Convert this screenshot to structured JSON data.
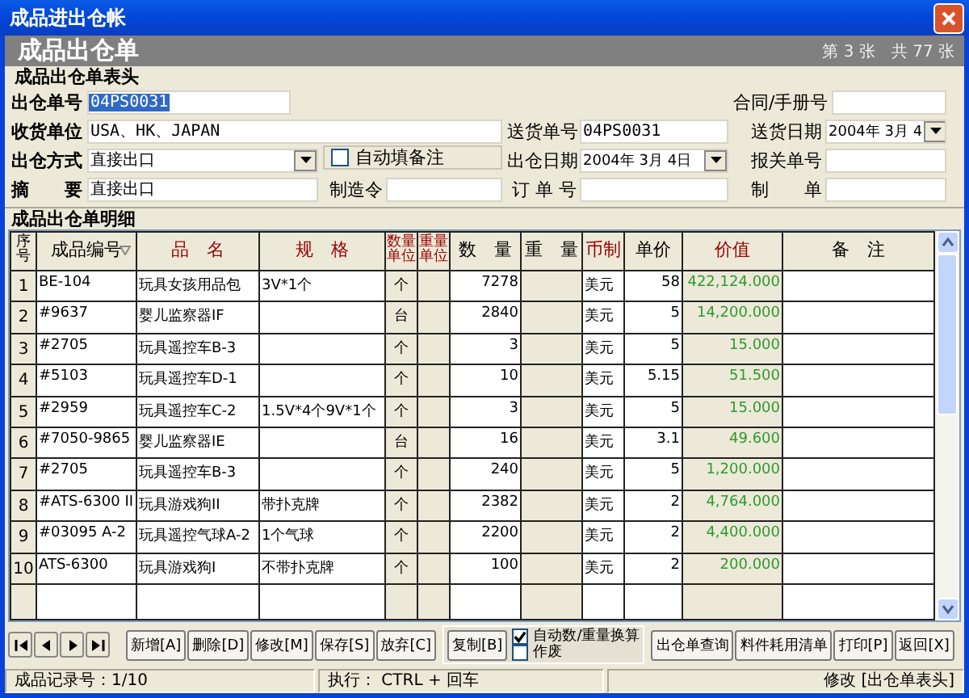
{
  "window": {
    "title": "成品进出仓帐"
  },
  "banner": {
    "title": "成品出仓单",
    "page": "第 3 张",
    "total": "共 77 张"
  },
  "header": {
    "title": "成品出仓单表头",
    "fields": [
      {
        "label": "出仓单号",
        "kind": "text",
        "value": "04PS0031",
        "highlighted": true
      },
      {
        "label": "合同/手册号",
        "kind": "text"
      },
      {
        "label": "收货单位",
        "kind": "text",
        "value": "USA、HK、JAPAN",
        "highlighted": false
      },
      {
        "label": "送货单号",
        "kind": "text",
        "value": "04PS0031",
        "highlighted": false
      },
      {
        "label": "送货日期",
        "kind": "select",
        "value": "2004年 3月 4"
      },
      {
        "label": "出仓方式",
        "kind": "select",
        "value": "直接出口"
      },
      {
        "label": "自动填备注",
        "kind": "checkbox",
        "checked": false
      },
      {
        "label": "出仓日期",
        "kind": "select",
        "value": "2004年 3月 4日"
      },
      {
        "label": "报关单号",
        "kind": "text"
      },
      {
        "label": "摘　　要",
        "kind": "text",
        "value": "直接出口",
        "highlighted": false
      },
      {
        "label": "制造令",
        "kind": "text"
      },
      {
        "label": "订 单 号",
        "kind": "text"
      },
      {
        "label": "制　　单",
        "kind": "text"
      }
    ]
  },
  "detail": {
    "title": "成品出仓单明细",
    "columns": [
      {
        "title": "序号",
        "kind": "index",
        "color": "#000000",
        "sorted": false
      },
      {
        "title": "成品编号",
        "kind": "text",
        "color": "#000000",
        "sorted": true
      },
      {
        "title": "品　名",
        "kind": "text",
        "color": "#990000",
        "sorted": false
      },
      {
        "title": "规　格",
        "kind": "text",
        "color": "#990000",
        "sorted": false
      },
      {
        "title": "数量单位",
        "kind": "unit",
        "color": "#990000",
        "sorted": false
      },
      {
        "title": "重量单位",
        "kind": "unit",
        "color": "#990000",
        "sorted": false
      },
      {
        "title": "数　量",
        "kind": "number",
        "color": "#000000",
        "sorted": false
      },
      {
        "title": "重　量",
        "kind": "shaded-number",
        "color": "#000000",
        "sorted": false
      },
      {
        "title": "币制",
        "kind": "text",
        "color": "#990000",
        "sorted": false
      },
      {
        "title": "单价",
        "kind": "number",
        "color": "#000000",
        "sorted": false
      },
      {
        "title": "价值",
        "kind": "value",
        "color": "#990000",
        "sorted": false
      },
      {
        "title": "备　注",
        "kind": "text",
        "color": "#000000",
        "sorted": false
      }
    ],
    "rows": [
      [
        "1",
        "BE-104",
        "玩具女孩用品包",
        "3V*1个",
        "个",
        null,
        "7278",
        null,
        "美元",
        "58",
        "422,124.000",
        null
      ],
      [
        "2",
        "#9637",
        "婴儿监察器IF",
        null,
        "台",
        null,
        "2840",
        null,
        "美元",
        "5",
        "14,200.000",
        null
      ],
      [
        "3",
        "#2705",
        "玩具遥控车B-3",
        null,
        "个",
        null,
        "3",
        null,
        "美元",
        "5",
        "15.000",
        null
      ],
      [
        "4",
        "#5103",
        "玩具遥控车D-1",
        null,
        "个",
        null,
        "10",
        null,
        "美元",
        "5.15",
        "51.500",
        null
      ],
      [
        "5",
        "#2959",
        "玩具遥控车C-2",
        "1.5V*4个9V*1个",
        "个",
        null,
        "3",
        null,
        "美元",
        "5",
        "15.000",
        null
      ],
      [
        "6",
        "#7050-9865",
        "婴儿监察器IE",
        null,
        "台",
        null,
        "16",
        null,
        "美元",
        "3.1",
        "49.600",
        null
      ],
      [
        "7",
        "#2705",
        "玩具遥控车B-3",
        null,
        "个",
        null,
        "240",
        null,
        "美元",
        "5",
        "1,200.000",
        null
      ],
      [
        "8",
        "#ATS-6300 II",
        "玩具游戏狗II",
        "带扑克牌",
        "个",
        null,
        "2382",
        null,
        "美元",
        "2",
        "4,764.000",
        null
      ],
      [
        "9",
        "#03095 A-2",
        "玩具遥控气球A-2",
        "1个气球",
        "个",
        null,
        "2200",
        null,
        "美元",
        "2",
        "4,400.000",
        null
      ],
      [
        "10",
        "ATS-6300",
        "玩具游戏狗I",
        "不带扑克牌",
        "个",
        null,
        "100",
        null,
        "美元",
        "2",
        "200.000",
        null
      ]
    ]
  },
  "toolbar": {
    "buttons": [
      "新增[A]",
      "删除[D]",
      "修改[M]",
      "保存[S]",
      "放弃[C]"
    ],
    "copy": "复制[B]",
    "checks": [
      {
        "label": "自动数/重量换算",
        "checked": true
      },
      {
        "label": "作废",
        "checked": false
      }
    ],
    "actions": [
      "出仓单查询",
      "料件耗用清单",
      "打印[P]",
      "返回[X]"
    ]
  },
  "status_bar": [
    "成品记录号：1/10",
    "执行： CTRL + 回车",
    "修改 [出仓单表头]"
  ]
}
